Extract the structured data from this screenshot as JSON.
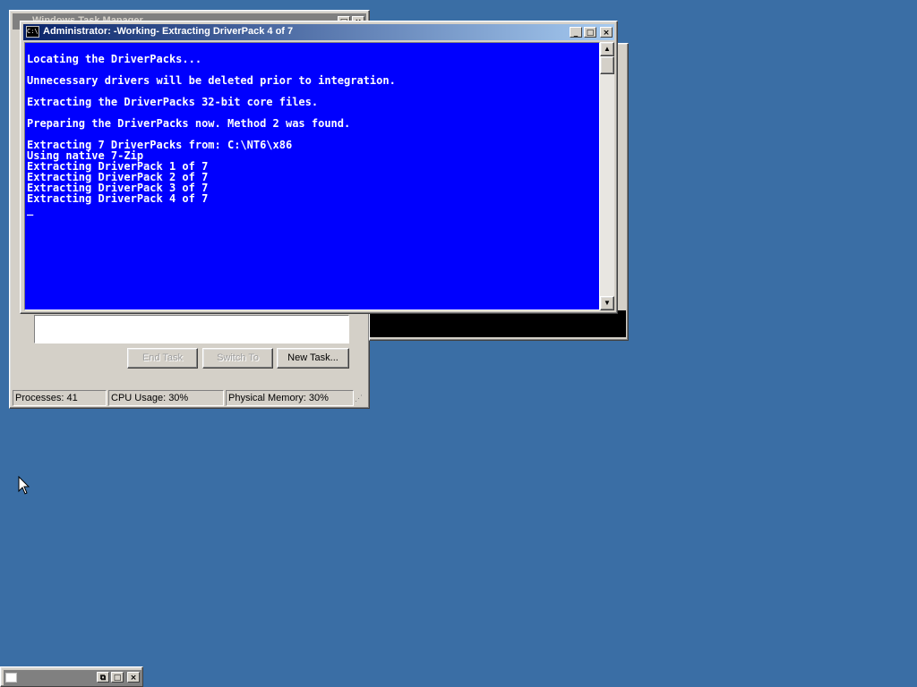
{
  "task_manager": {
    "title": "Windows Task Manager",
    "buttons": {
      "end_task": "End Task",
      "switch_to": "Switch To",
      "new_task": "New Task..."
    },
    "status": {
      "processes": "Processes: 41",
      "cpu": "CPU Usage: 30%",
      "memory": "Physical Memory: 30%"
    }
  },
  "console": {
    "title": "Administrator:  -Working- Extracting DriverPack 4 of 7",
    "lines": [
      "Locating the DriverPacks...",
      "",
      "Unnecessary drivers will be deleted prior to integration.",
      "",
      "Extracting the DriverPacks 32-bit core files.",
      "",
      "Preparing the DriverPacks now. Method 2 was found.",
      "",
      "Extracting 7 DriverPacks from: C:\\NT6\\x86",
      "Using native 7-Zip",
      "Extracting DriverPack 1 of 7",
      "Extracting DriverPack 2 of 7",
      "Extracting DriverPack 3 of 7",
      "Extracting DriverPack 4 of 7",
      "_"
    ],
    "background_color": "#0000fe",
    "text_color": "#ffffff"
  },
  "desktop": {
    "background_color": "#3a6ea5"
  },
  "icons": {
    "minimize": "minimize-icon",
    "maximize": "maximize-icon",
    "close": "close-icon",
    "restore": "restore-icon",
    "cmd": "cmd-icon",
    "cursor": "mouse-cursor-icon"
  }
}
